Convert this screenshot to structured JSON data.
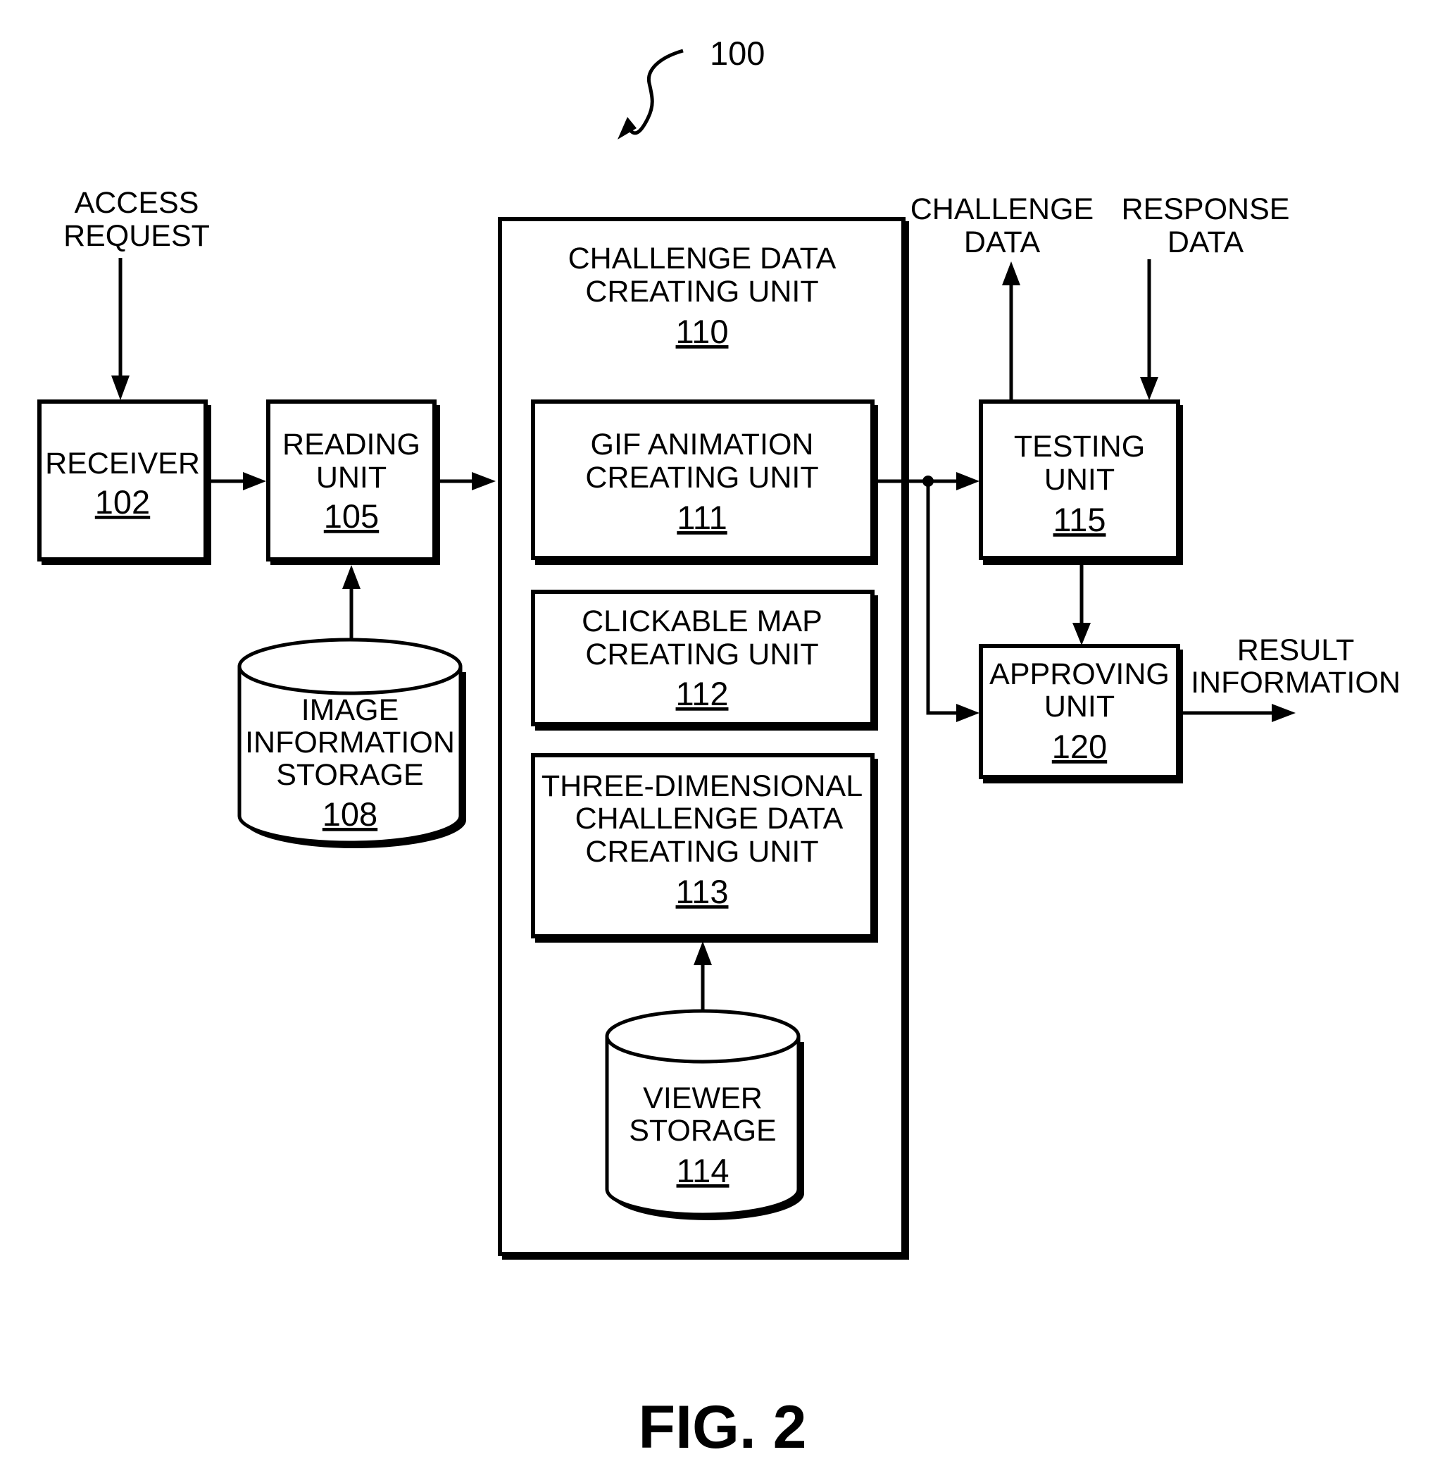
{
  "figure": {
    "title": "FIG. 2",
    "reference_numeral": "100"
  },
  "external_labels": {
    "access_request": [
      "ACCESS",
      "REQUEST"
    ],
    "challenge_data": [
      "CHALLENGE",
      "DATA"
    ],
    "response_data": [
      "RESPONSE",
      "DATA"
    ],
    "result_information": [
      "RESULT",
      "INFORMATION"
    ]
  },
  "blocks": {
    "receiver": {
      "lines": [
        "RECEIVER"
      ],
      "number": "102"
    },
    "reading_unit": {
      "lines": [
        "READING",
        "UNIT"
      ],
      "number": "105"
    },
    "image_information_storage": {
      "lines": [
        "IMAGE",
        "INFORMATION",
        "STORAGE"
      ],
      "number": "108"
    },
    "challenge_data_creating_unit": {
      "lines": [
        "CHALLENGE DATA",
        "CREATING UNIT"
      ],
      "number": "110"
    },
    "gif_animation_creating_unit": {
      "lines": [
        "GIF ANIMATION",
        "CREATING UNIT"
      ],
      "number": "111"
    },
    "clickable_map_creating_unit": {
      "lines": [
        "CLICKABLE MAP",
        "CREATING UNIT"
      ],
      "number": "112"
    },
    "three_dimensional_creating_unit": {
      "lines": [
        "THREE-DIMENSIONAL",
        "CHALLENGE DATA",
        "CREATING UNIT"
      ],
      "number": "113"
    },
    "viewer_storage": {
      "lines": [
        "VIEWER",
        "STORAGE"
      ],
      "number": "114"
    },
    "testing_unit": {
      "lines": [
        "TESTING",
        "UNIT"
      ],
      "number": "115"
    },
    "approving_unit": {
      "lines": [
        "APPROVING",
        "UNIT"
      ],
      "number": "120"
    }
  }
}
